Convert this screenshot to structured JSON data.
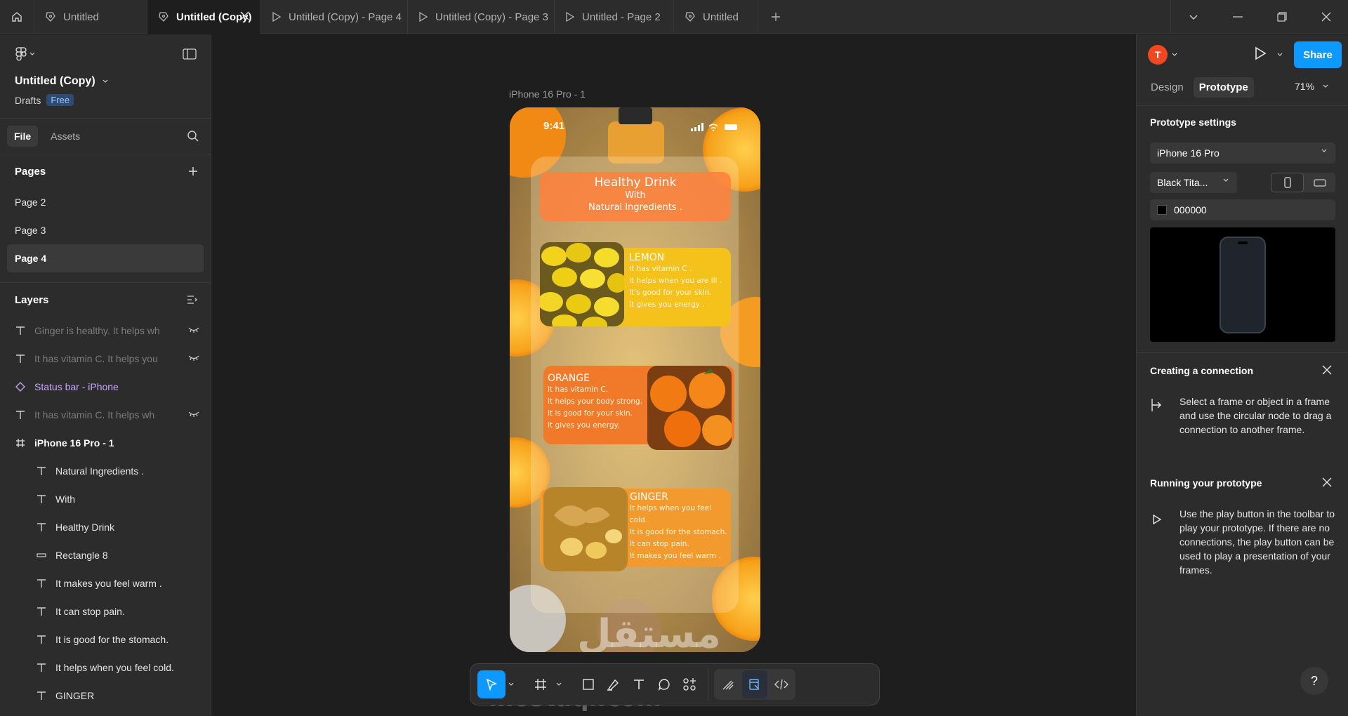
{
  "tabs": [
    {
      "label": "Untitled",
      "icon": "file-icon",
      "width": 161
    },
    {
      "label": "Untitled (Copy)",
      "icon": "file-icon",
      "width": 162,
      "active": true
    },
    {
      "label": "Untitled (Copy) - Page 4",
      "icon": "play-icon",
      "width": 209
    },
    {
      "label": "Untitled (Copy) - Page 3",
      "icon": "play-icon",
      "width": 209
    },
    {
      "label": "Untitled - Page 2",
      "icon": "play-icon",
      "width": 170
    },
    {
      "label": "Untitled",
      "icon": "file-icon",
      "width": 120
    }
  ],
  "left_panel": {
    "file_title": "Untitled (Copy)",
    "location": "Drafts",
    "plan_badge": "Free",
    "tabs": {
      "file": "File",
      "assets": "Assets"
    },
    "pages_title": "Pages",
    "pages": [
      "Page 2",
      "Page 3",
      "Page 4"
    ],
    "active_page": "Page 4",
    "layers_title": "Layers",
    "layers": [
      {
        "name": "Ginger is healthy.  It helps wh",
        "icon": "text-icon",
        "indent": 0,
        "hidden": true
      },
      {
        "name": "It has vitamin C.  It helps you",
        "icon": "text-icon",
        "indent": 0,
        "hidden": true
      },
      {
        "name": "Status bar - iPhone",
        "icon": "component-icon",
        "indent": 0
      },
      {
        "name": "It has vitamin C.  It helps wh",
        "icon": "text-icon",
        "indent": 0,
        "hidden": true
      },
      {
        "name": "iPhone 16 Pro - 1",
        "icon": "frame-icon",
        "indent": 0,
        "bold": true
      },
      {
        "name": "Natural Ingredients .",
        "icon": "text-icon",
        "indent": 1
      },
      {
        "name": "With",
        "icon": "text-icon",
        "indent": 1
      },
      {
        "name": "Healthy Drink",
        "icon": "text-icon",
        "indent": 1
      },
      {
        "name": "Rectangle 8",
        "icon": "rectangle-icon",
        "indent": 1
      },
      {
        "name": "It makes you feel warm .",
        "icon": "text-icon",
        "indent": 1
      },
      {
        "name": "It can stop pain.",
        "icon": "text-icon",
        "indent": 1
      },
      {
        "name": "It is good for the stomach.",
        "icon": "text-icon",
        "indent": 1
      },
      {
        "name": "It helps when you feel cold.",
        "icon": "text-icon",
        "indent": 1
      },
      {
        "name": "GINGER",
        "icon": "text-icon",
        "indent": 1
      }
    ]
  },
  "canvas": {
    "frame_label": "iPhone 16 Pro - 1",
    "status_time": "9:41",
    "hero": {
      "title": "Healthy Drink",
      "line1": "With",
      "line2": "Natural Ingredients ."
    },
    "cards": [
      {
        "title": "LEMON",
        "lines": [
          "It has vitamin C .",
          "It helps when you are ill .",
          "It's good for your skin.",
          "It gives you energy ."
        ],
        "color": "#f5c21b"
      },
      {
        "title": "ORANGE",
        "lines": [
          "It has vitamin C.",
          "It helps your body strong.",
          "It is good for your skin.",
          "It gives you energy."
        ],
        "color": "#f07a2a"
      },
      {
        "title": "GINGER",
        "lines": [
          "It helps when you feel cold.",
          "It is good for the stomach.",
          "It can stop pain.",
          "It makes you feel warm ."
        ],
        "color": "#f39a2e"
      }
    ],
    "watermark": "mostaql.com",
    "watermark_ar": "مستقل"
  },
  "toolbar": {
    "tools": [
      "move-tool",
      "frame-tool",
      "rectangle-tool",
      "pen-tool",
      "text-tool",
      "comment-tool",
      "actions-tool"
    ],
    "modes": [
      "draw-mode",
      "design-mode",
      "dev-mode"
    ]
  },
  "right_panel": {
    "avatar_initial": "T",
    "share_label": "Share",
    "tabs": {
      "design": "Design",
      "prototype": "Prototype"
    },
    "zoom": "71%",
    "prototype_settings_title": "Prototype settings",
    "device": "iPhone 16 Pro",
    "model": "Black Tita...",
    "background_color": "000000",
    "connection_title": "Creating a connection",
    "connection_text": "Select a frame or object in a frame and use the circular node to drag a connection to another frame.",
    "running_title": "Running your prototype",
    "running_text": "Use the play button in the toolbar to play your prototype. If there are no connections, the play button can be used to play a presentation of your frames.",
    "help": "?"
  },
  "colors": {
    "accent": "#0d99ff",
    "avatar": "#f24822",
    "component": "#c9a6ff"
  }
}
